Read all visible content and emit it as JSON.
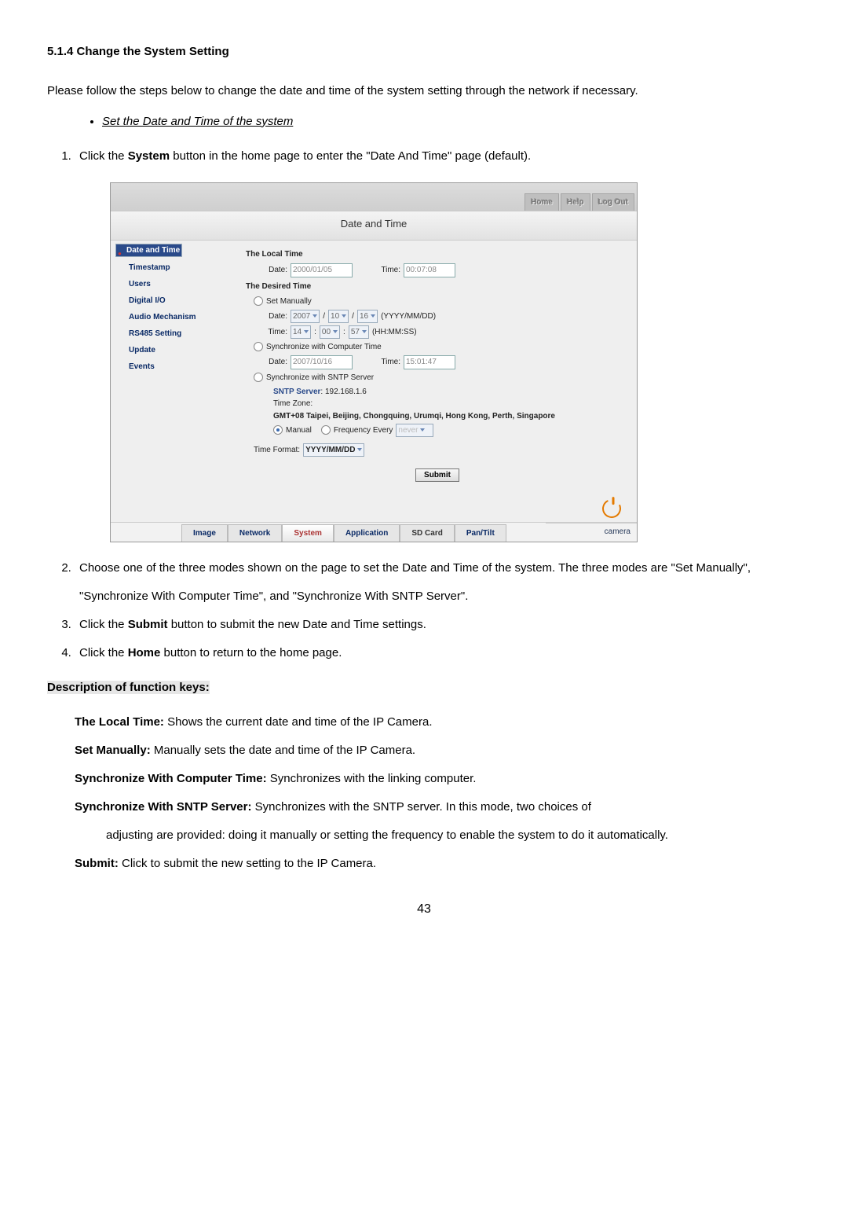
{
  "heading": "5.1.4  Change the System Setting",
  "intro": "Please follow the steps below to change the date and time of the system setting through the network if necessary.",
  "bullet": "Set the Date and Time of the system",
  "steps": {
    "s1_a": "Click the ",
    "s1_b": "System",
    "s1_c": " button in the home page to enter the \"Date And Time\" page (default).",
    "s2": "Choose one of the three modes shown on the page to set the Date and Time of the system. The three modes are \"Set Manually\", \"Synchronize With Computer Time\", and \"Synchronize With SNTP Server\".",
    "s3_a": "Click the ",
    "s3_b": "Submit",
    "s3_c": " button to submit the new Date and Time settings.",
    "s4_a": "Click the ",
    "s4_b": "Home",
    "s4_c": " button to return to the home page."
  },
  "desc_heading": "Description of function keys:",
  "desc": {
    "d1_b": "The Local Time:",
    "d1_t": " Shows the current date and time of the IP Camera.",
    "d2_b": "Set Manually:",
    "d2_t": " Manually sets the date and time of the IP Camera.",
    "d3_b": "Synchronize With Computer Time:",
    "d3_t": " Synchronizes with the linking computer.",
    "d4_b": "Synchronize With SNTP Server:",
    "d4_t": " Synchronizes with the SNTP server. In this mode, two choices of",
    "d4_sub": "adjusting are provided: doing it manually or setting the frequency to enable the system to do it automatically.",
    "d5_b": "Submit:",
    "d5_t": " Click to submit the new setting to the IP Camera."
  },
  "page_number": "43",
  "shot": {
    "topnav": {
      "home": "Home",
      "help": "Help",
      "logout": "Log Out"
    },
    "title": "Date and Time",
    "side": [
      "Date and Time",
      "Timestamp",
      "Users",
      "Digital I/O",
      "Audio Mechanism",
      "RS485 Setting",
      "Update",
      "Events"
    ],
    "local_heading": "The Local Time",
    "date_lbl": "Date:",
    "time_lbl": "Time:",
    "local_date": "2000/01/05",
    "local_time": "00:07:08",
    "desired_heading": "The Desired Time",
    "opt_manual": "Set Manually",
    "man_year": "2007",
    "man_mon": "10",
    "man_day": "16",
    "man_date_hint": "(YYYY/MM/DD)",
    "man_hh": "14",
    "man_mm": "00",
    "man_ss": "57",
    "man_time_hint": "(HH:MM:SS)",
    "opt_comp": "Synchronize with Computer Time",
    "comp_date": "2007/10/16",
    "comp_time": "15:01:47",
    "opt_sntp": "Synchronize with SNTP Server",
    "sntp_lbl": "SNTP Server",
    "sntp_val": ": 192.168.1.6",
    "tz_lbl": "Time Zone:",
    "tz_val": "GMT+08 Taipei, Beijing, Chongquing, Urumqi, Hong Kong, Perth, Singapore",
    "sntp_manual": "Manual",
    "sntp_freq": "Frequency Every",
    "sntp_freq_val": "never",
    "tf_lbl": "Time Format:",
    "tf_val": "YYYY/MM/DD",
    "submit": "Submit",
    "bottom": {
      "image": "Image",
      "network": "Network",
      "system": "System",
      "application": "Application",
      "sd": "SD Card",
      "pan": "Pan/Tilt"
    },
    "camera": "camera"
  }
}
